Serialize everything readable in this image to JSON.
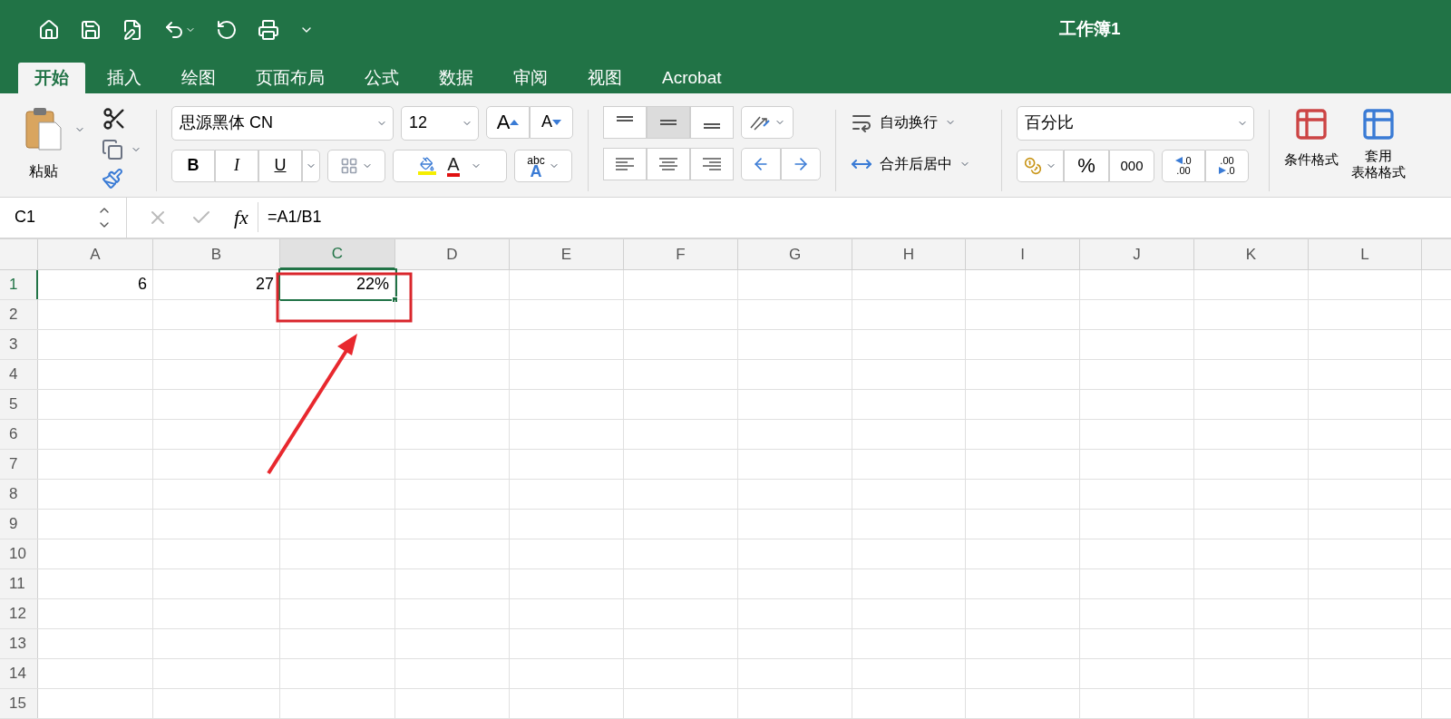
{
  "window": {
    "title": "工作簿1"
  },
  "tabs": [
    {
      "label": "开始",
      "selected": true
    },
    {
      "label": "插入",
      "selected": false
    },
    {
      "label": "绘图",
      "selected": false
    },
    {
      "label": "页面布局",
      "selected": false
    },
    {
      "label": "公式",
      "selected": false
    },
    {
      "label": "数据",
      "selected": false
    },
    {
      "label": "审阅",
      "selected": false
    },
    {
      "label": "视图",
      "selected": false
    },
    {
      "label": "Acrobat",
      "selected": false
    }
  ],
  "ribbon": {
    "paste": "粘贴",
    "font_name": "思源黑体 CN",
    "font_size": "12",
    "grow_font": "A",
    "shrink_font": "A",
    "bold": "B",
    "italic": "I",
    "underline": "U",
    "font_color": "A",
    "phonetic": {
      "top": "abc",
      "bottom": "A"
    },
    "wrap_text": "自动换行",
    "merge_center": "合并后居中",
    "number_format": "百分比",
    "percent": "%",
    "comma": "000",
    "increase_decimal": {
      "top": ".0",
      "bottom": ".00"
    },
    "decrease_decimal": {
      "top": ".00",
      "bottom": ".0"
    },
    "conditional_format": "条件格式",
    "format_as_table": {
      "line1": "套用",
      "line2": "表格格式"
    },
    "vertical_align": [
      {
        "selected": false
      },
      {
        "selected": true
      },
      {
        "selected": false
      }
    ]
  },
  "formula_bar": {
    "name_box": "C1",
    "fx": "fx",
    "formula": "=A1/B1"
  },
  "columns": [
    {
      "label": "A",
      "selected": false
    },
    {
      "label": "B",
      "selected": false
    },
    {
      "label": "C",
      "selected": true
    },
    {
      "label": "D",
      "selected": false
    },
    {
      "label": "E",
      "selected": false
    },
    {
      "label": "F",
      "selected": false
    },
    {
      "label": "G",
      "selected": false
    },
    {
      "label": "H",
      "selected": false
    },
    {
      "label": "I",
      "selected": false
    },
    {
      "label": "J",
      "selected": false
    },
    {
      "label": "K",
      "selected": false
    },
    {
      "label": "L",
      "selected": false
    }
  ],
  "rows": [
    {
      "label": "1",
      "selected": true,
      "values": [
        "6",
        "27",
        "22%"
      ]
    },
    {
      "label": "2",
      "selected": false
    },
    {
      "label": "3",
      "selected": false
    },
    {
      "label": "4",
      "selected": false
    },
    {
      "label": "5",
      "selected": false
    },
    {
      "label": "6",
      "selected": false
    },
    {
      "label": "7",
      "selected": false
    },
    {
      "label": "8",
      "selected": false
    },
    {
      "label": "9",
      "selected": false
    },
    {
      "label": "10",
      "selected": false
    },
    {
      "label": "11",
      "selected": false
    },
    {
      "label": "12",
      "selected": false
    },
    {
      "label": "13",
      "selected": false
    },
    {
      "label": "14",
      "selected": false
    },
    {
      "label": "15",
      "selected": false
    }
  ]
}
